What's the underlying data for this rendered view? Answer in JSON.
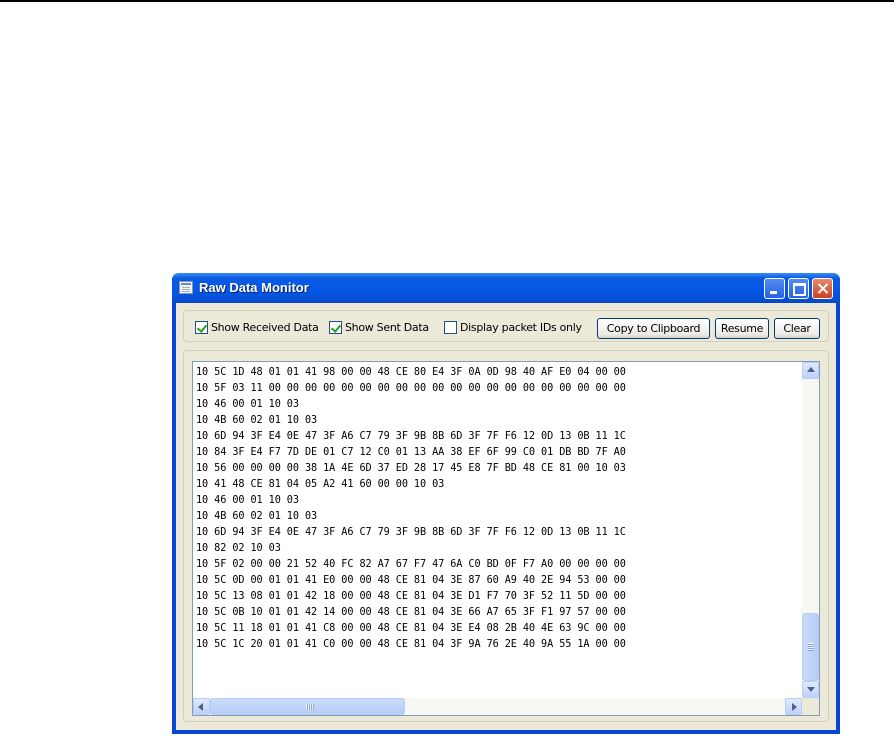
{
  "window": {
    "title": "Raw Data Monitor"
  },
  "toolbar": {
    "show_received_label": "Show Received Data",
    "show_received_checked": true,
    "show_sent_label": "Show Sent Data",
    "show_sent_checked": true,
    "packet_ids_label": "Display packet IDs only",
    "packet_ids_checked": false,
    "copy_label": "Copy to Clipboard",
    "resume_label": "Resume",
    "clear_label": "Clear"
  },
  "data_lines": [
    "10 5C 1D 48 01 01 41 98 00 00 48 CE 80 E4 3F 0A 0D 98 40 AF E0 04 00 00",
    "10 5F 03 11 00 00 00 00 00 00 00 00 00 00 00 00 00 00 00 00 00 00 00 00",
    "10 46 00 01 10 03",
    "10 4B 60 02 01 10 03",
    "10 6D 94 3F E4 0E 47 3F A6 C7 79 3F 9B 8B 6D 3F 7F F6 12 0D 13 0B 11 1C",
    "10 84 3F E4 F7 7D DE 01 C7 12 C0 01 13 AA 38 EF 6F 99 C0 01 DB BD 7F A0",
    "10 56 00 00 00 00 38 1A 4E 6D 37 ED 28 17 45 E8 7F BD 48 CE 81 00 10 03",
    "10 41 48 CE 81 04 05 A2 41 60 00 00 10 03",
    "10 46 00 01 10 03",
    "10 4B 60 02 01 10 03",
    "10 6D 94 3F E4 0E 47 3F A6 C7 79 3F 9B 8B 6D 3F 7F F6 12 0D 13 0B 11 1C",
    "10 82 02 10 03",
    "10 5F 02 00 00 21 52 40 FC 82 A7 67 F7 47 6A C0 BD 0F F7 A0 00 00 00 00",
    "10 5C 0D 00 01 01 41 E0 00 00 48 CE 81 04 3E 87 60 A9 40 2E 94 53 00 00",
    "10 5C 13 08 01 01 42 18 00 00 48 CE 81 04 3E D1 F7 70 3F 52 11 5D 00 00",
    "10 5C 0B 10 01 01 42 14 00 00 48 CE 81 04 3E 66 A7 65 3F F1 97 57 00 00",
    "10 5C 11 18 01 01 41 C8 00 00 48 CE 81 04 3E E4 08 2B 40 4E 63 9C 00 00",
    "10 5C 1C 20 01 01 41 C0 00 00 48 CE 81 04 3F 9A 76 2E 40 9A 55 1A 00 00"
  ],
  "icons": {
    "app": "data-monitor-icon",
    "minimize": "minimize-icon",
    "maximize": "maximize-icon",
    "close": "close-icon",
    "scroll_up": "arrow-up-icon",
    "scroll_down": "arrow-down-icon",
    "scroll_left": "arrow-left-icon",
    "scroll_right": "arrow-right-icon"
  },
  "colors": {
    "titlebar": "#0858e8",
    "close_button": "#c8401e",
    "checkmark": "#21a121",
    "face": "#ece9d8"
  }
}
